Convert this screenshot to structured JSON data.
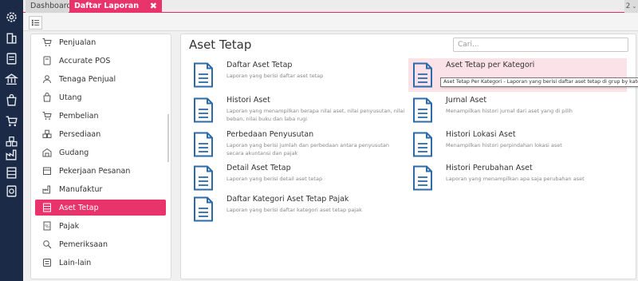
{
  "tabs": {
    "dashboard": "Dashboard",
    "active": "Daftar Laporan",
    "close_glyph": "✖",
    "count": "2"
  },
  "categories": [
    {
      "label": "Penjualan",
      "icon": "cart-icon"
    },
    {
      "label": "Accurate POS",
      "icon": "pos-icon"
    },
    {
      "label": "Tenaga Penjual",
      "icon": "salesperson-icon"
    },
    {
      "label": "Utang",
      "icon": "debt-icon"
    },
    {
      "label": "Pembelian",
      "icon": "purchase-icon"
    },
    {
      "label": "Persediaan",
      "icon": "inventory-icon"
    },
    {
      "label": "Gudang",
      "icon": "warehouse-icon"
    },
    {
      "label": "Pekerjaan Pesanan",
      "icon": "job-order-icon"
    },
    {
      "label": "Manufaktur",
      "icon": "factory-icon"
    },
    {
      "label": "Aset Tetap",
      "icon": "fixed-asset-icon",
      "active": true
    },
    {
      "label": "Pajak",
      "icon": "tax-icon"
    },
    {
      "label": "Pemeriksaan",
      "icon": "audit-icon"
    },
    {
      "label": "Lain-lain",
      "icon": "others-icon"
    }
  ],
  "main": {
    "title": "Aset Tetap",
    "search_placeholder": "Cari..."
  },
  "reports": [
    {
      "title": "Daftar Aset Tetap",
      "desc": "Laporan yang berisi daftar aset tetap"
    },
    {
      "title": "Aset Tetap per Kategori",
      "desc": "",
      "highlighted": true
    },
    {
      "title": "Histori Aset",
      "desc": "Laporan yang menampilkan berapa nilai aset, nilai penyusutan, nilai beban, nilai buku dan laba rugi"
    },
    {
      "title": "Jurnal Aset",
      "desc": "Menampilkan histori jurnal dari aset yang di pilih"
    },
    {
      "title": "Perbedaan Penyusutan",
      "desc": "Laporan yang berisi jumlah dan perbedaan antara penyusutan secara akuntansi dan pajak"
    },
    {
      "title": "Histori Lokasi Aset",
      "desc": "Menampilkan histori perpindahan lokasi aset"
    },
    {
      "title": "Detail Aset Tetap",
      "desc": "Laporan yang berisi detail aset tetap"
    },
    {
      "title": "Histori Perubahan Aset",
      "desc": "Laporan yang menampilkan apa saja perubahan aset"
    },
    {
      "title": "Daftar Kategori Aset Tetap Pajak",
      "desc": "Laporan yang berisi daftar kategori aset tetap pajak"
    }
  ],
  "tooltip": "Aset Tetap Per Kategori - Laporan yang berisi daftar aset tetap di grup by kategori aset",
  "rail_icons": [
    "settings-icon",
    "company-icon",
    "ledger-icon",
    "bank-icon",
    "sales-icon",
    "purchase-cart-icon",
    "inventory-box-icon",
    "factory-icon",
    "asset-building-icon",
    "reports-icon",
    "tax-icon"
  ],
  "colors": {
    "accent": "#e8336b",
    "rail": "#1b2a47",
    "icon_blue": "#2d6aa8"
  }
}
